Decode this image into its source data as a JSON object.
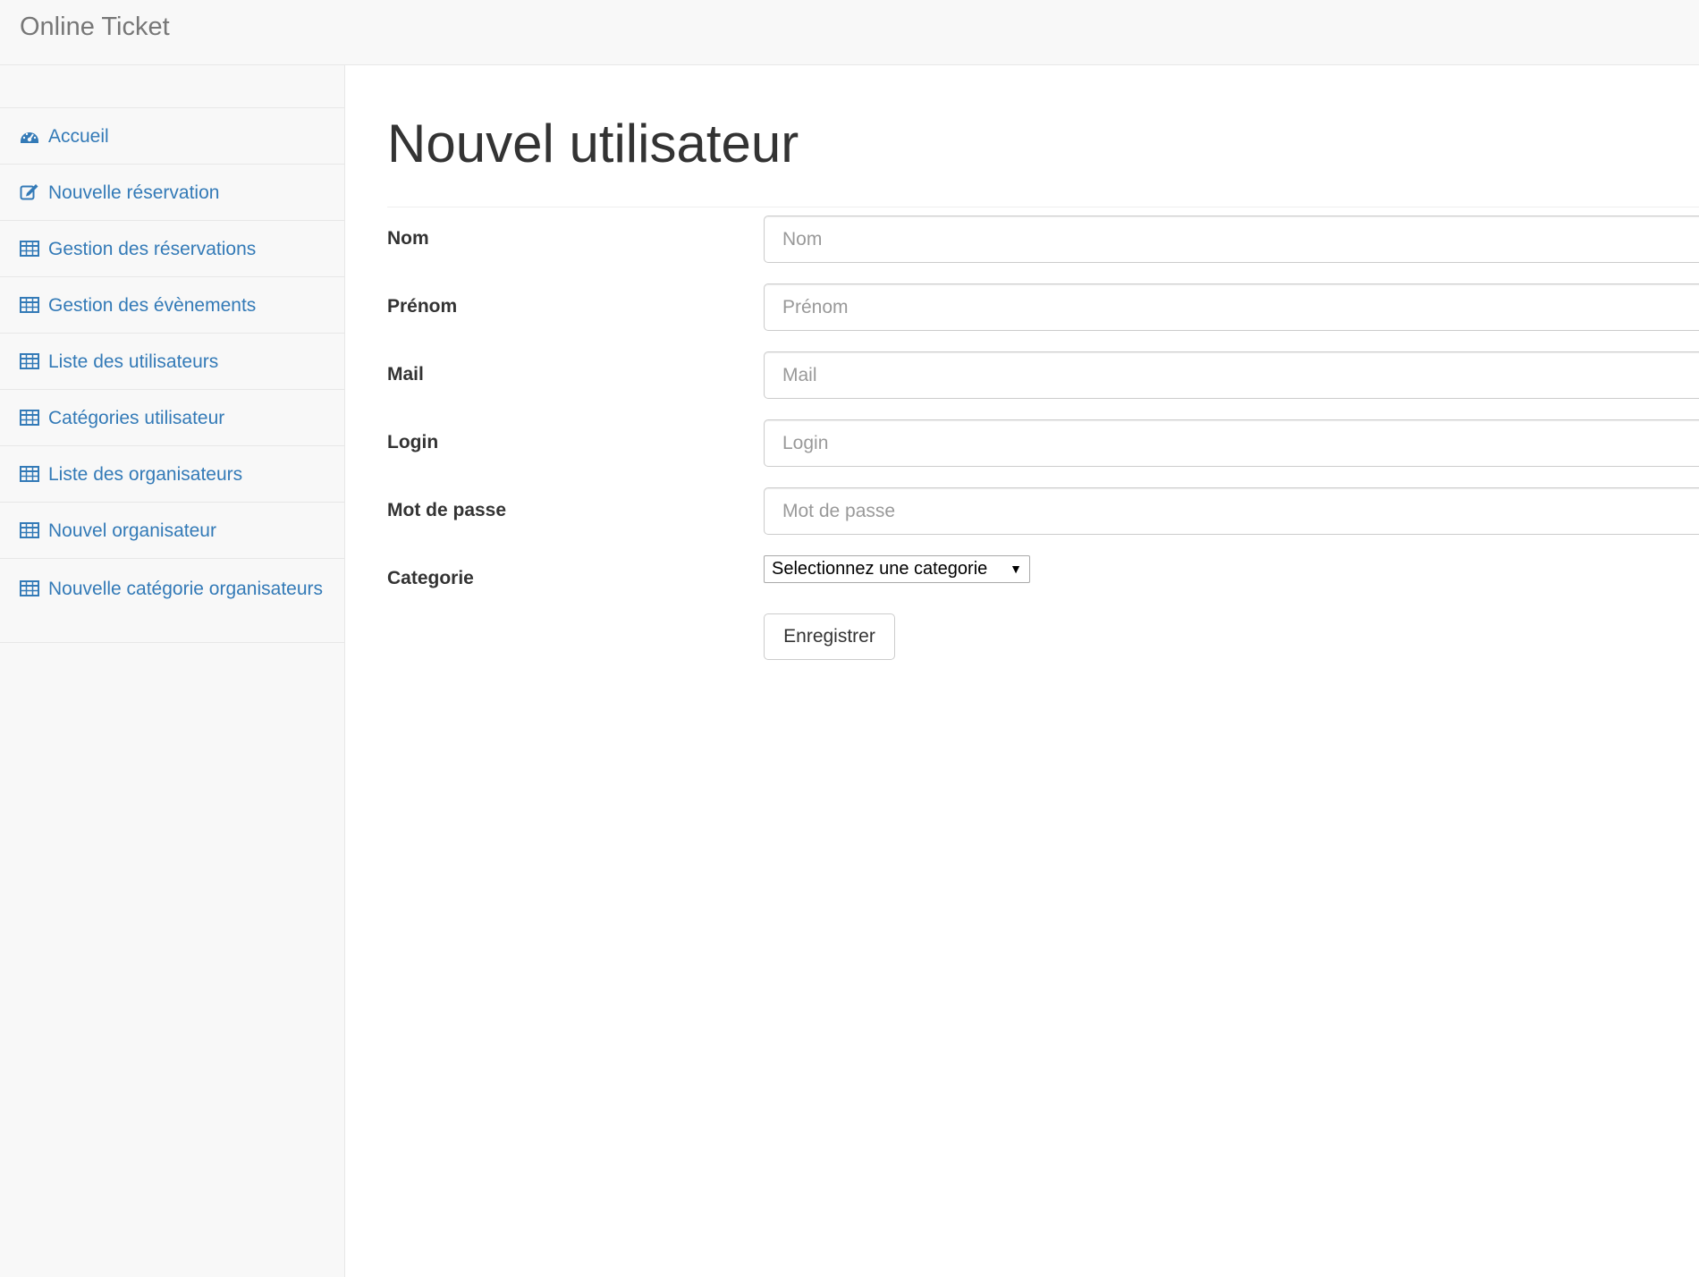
{
  "navbar": {
    "brand": "Online Ticket"
  },
  "sidebar": {
    "items": [
      {
        "label": "Accueil",
        "icon": "dashboard-icon"
      },
      {
        "label": "Nouvelle réservation",
        "icon": "edit-icon"
      },
      {
        "label": "Gestion des réservations",
        "icon": "table-icon"
      },
      {
        "label": "Gestion des évènements",
        "icon": "table-icon"
      },
      {
        "label": "Liste des utilisateurs",
        "icon": "table-icon"
      },
      {
        "label": "Catégories utilisateur",
        "icon": "table-icon"
      },
      {
        "label": "Liste des organisateurs",
        "icon": "table-icon"
      },
      {
        "label": "Nouvel organisateur",
        "icon": "table-icon"
      },
      {
        "label": "Nouvelle catégorie organisateurs",
        "icon": "table-icon"
      }
    ]
  },
  "main": {
    "title": "Nouvel utilisateur",
    "fields": [
      {
        "label": "Nom",
        "placeholder": "Nom",
        "value": ""
      },
      {
        "label": "Prénom",
        "placeholder": "Prénom",
        "value": ""
      },
      {
        "label": "Mail",
        "placeholder": "Mail",
        "value": ""
      },
      {
        "label": "Login",
        "placeholder": "Login",
        "value": ""
      },
      {
        "label": "Mot de passe",
        "placeholder": "Mot de passe",
        "value": ""
      }
    ],
    "category": {
      "label": "Categorie",
      "selected": "Selectionnez une categorie"
    },
    "submit_label": "Enregistrer"
  },
  "colors": {
    "link": "#337ab7",
    "navbar_bg": "#f8f8f8",
    "border": "#e7e7e7",
    "text": "#333333",
    "brand": "#777777"
  }
}
